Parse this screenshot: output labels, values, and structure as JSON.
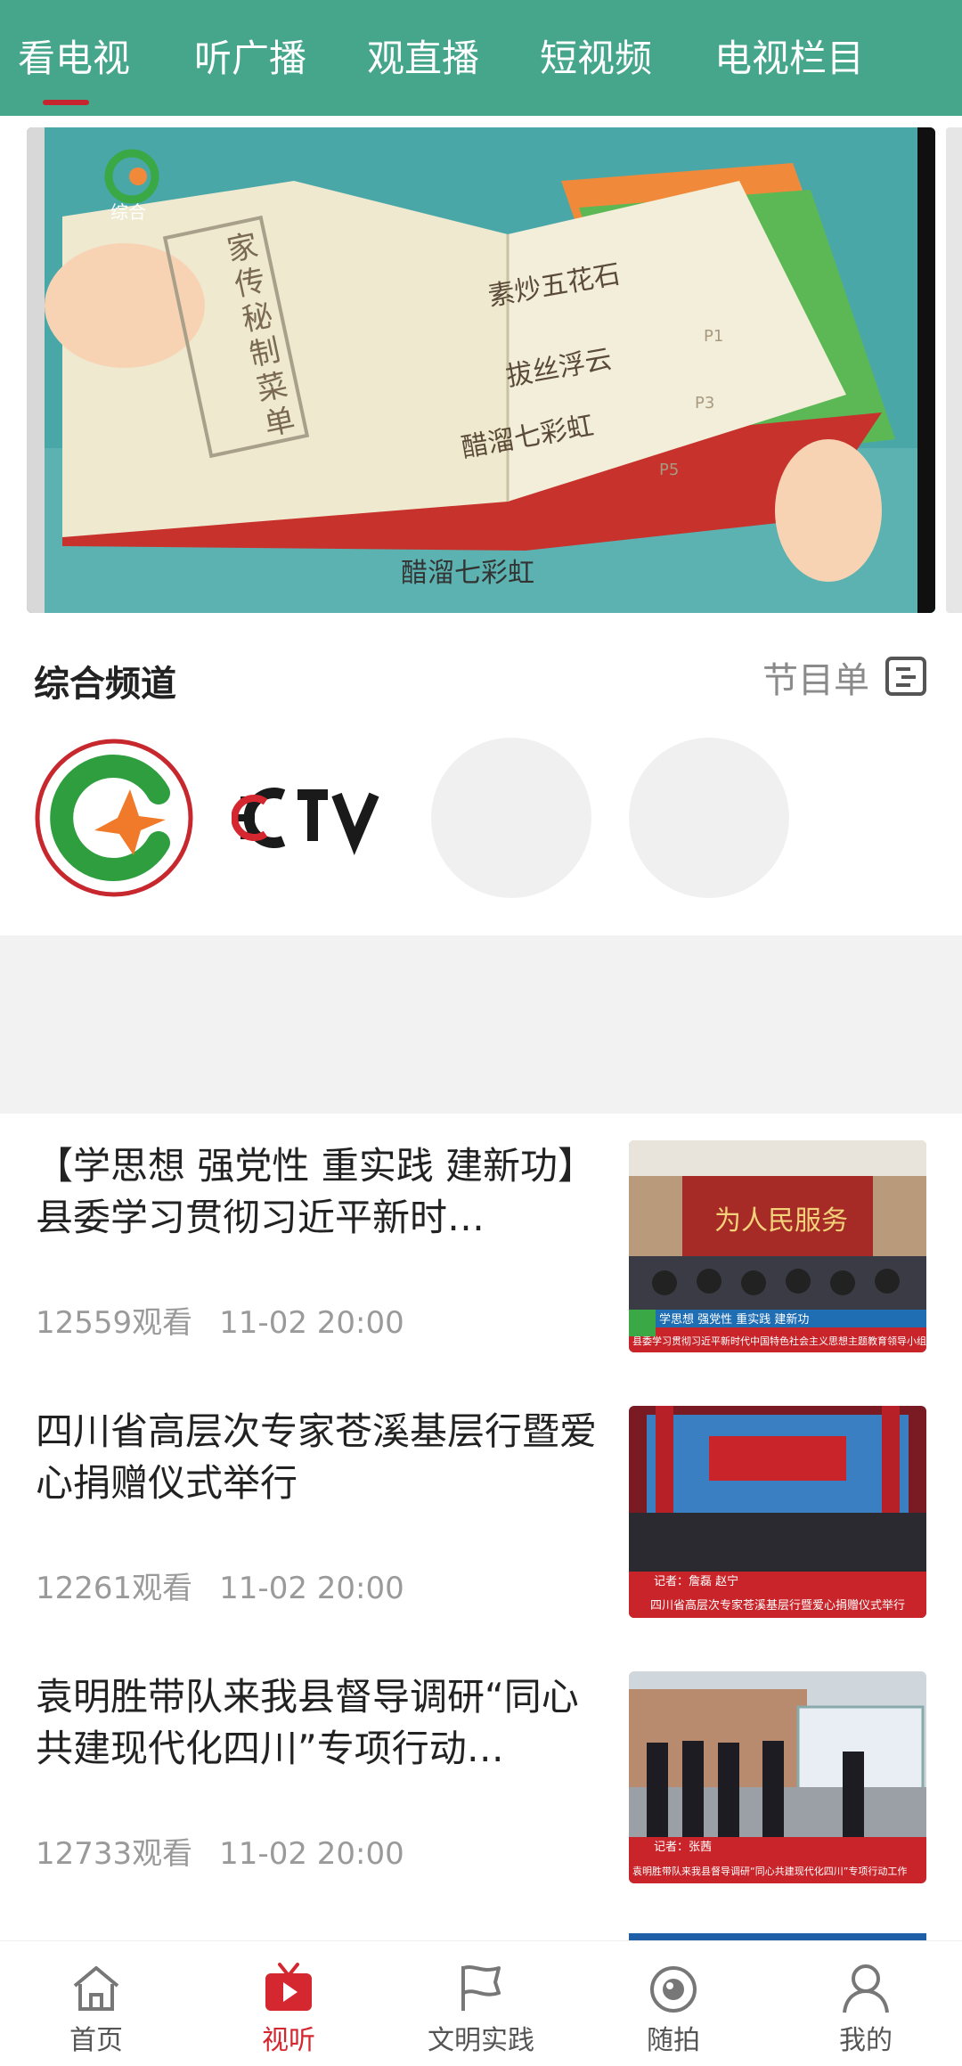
{
  "top_tabs": [
    {
      "label": "看电视",
      "active": true
    },
    {
      "label": "听广播",
      "active": false
    },
    {
      "label": "观直播",
      "active": false
    },
    {
      "label": "短视频",
      "active": false
    },
    {
      "label": "电视栏目",
      "active": false
    }
  ],
  "banner": {
    "channel_badge": "综合",
    "book_cover_title": "家传秘制菜单",
    "menu_items": [
      {
        "name": "素炒五花石",
        "page": "P1"
      },
      {
        "name": "拔丝浮云",
        "page": "P3"
      },
      {
        "name": "醋溜七彩虹",
        "page": "P5"
      }
    ],
    "subtitle": "醋溜七彩虹"
  },
  "channels_section": {
    "title": "综合频道",
    "schedule_label": "节目单",
    "channel_logos": [
      "cctv-logo"
    ]
  },
  "news": [
    {
      "title": "【学思想 强党性 重实践 建新功】县委学习贯彻习近平新时…",
      "views": "12559观看",
      "time": "11-02 20:00",
      "thumb_caption_top": "学思想 强党性 重实践 建新功",
      "thumb_caption": "县委学习贯彻习近平新时代中国特色社会主义思想主题教育领导小组第二次会议召开",
      "thumb_banner": "为人民服务"
    },
    {
      "title": "四川省高层次专家苍溪基层行暨爱心捐赠仪式举行",
      "views": "12261观看",
      "time": "11-02 20:00",
      "thumb_caption_top": "记者：詹磊 赵宁",
      "thumb_caption": "四川省高层次专家苍溪基层行暨爱心捐赠仪式举行"
    },
    {
      "title": "袁明胜带队来我县督导调研“同心共建现代化四川”专项行动…",
      "views": "12733观看",
      "time": "11-02 20:00",
      "thumb_caption_top": "记者：张茜",
      "thumb_caption": "袁明胜带队来我县督导调研“同心共建现代化四川”专项行动工作"
    }
  ],
  "bottom_nav": [
    {
      "label": "首页",
      "icon": "home-icon",
      "active": false
    },
    {
      "label": "视听",
      "icon": "tv-play-icon",
      "active": true
    },
    {
      "label": "文明实践",
      "icon": "flag-icon",
      "active": false
    },
    {
      "label": "随拍",
      "icon": "camera-icon",
      "active": false
    },
    {
      "label": "我的",
      "icon": "user-icon",
      "active": false
    }
  ],
  "colors": {
    "header_green": "#45a68c",
    "accent_red": "#d4272f",
    "muted_text": "#9a9a9a"
  }
}
